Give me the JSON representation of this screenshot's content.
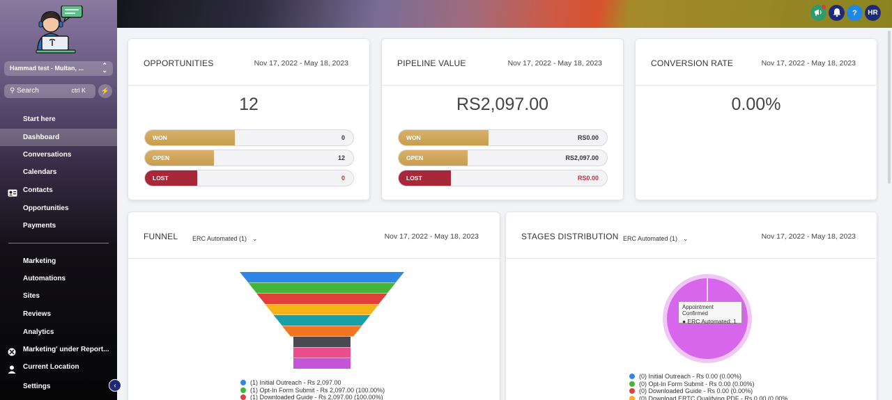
{
  "sidebar": {
    "account": "Hammad test - Multan, ...",
    "search_label": "Search",
    "search_shortcut": "ctrl K",
    "items": [
      {
        "label": "Start here"
      },
      {
        "label": "Dashboard"
      },
      {
        "label": "Conversations"
      },
      {
        "label": "Calendars"
      },
      {
        "label": "Contacts"
      },
      {
        "label": "Opportunities"
      },
      {
        "label": "Payments"
      },
      {
        "label": "Marketing"
      },
      {
        "label": "Automations"
      },
      {
        "label": "Sites"
      },
      {
        "label": "Reviews"
      },
      {
        "label": "Analytics"
      },
      {
        "label": "Marketing' under Report..."
      },
      {
        "label": "Current Location"
      },
      {
        "label": "Settings"
      }
    ]
  },
  "header": {
    "user_initials": "HR",
    "help_label": "?"
  },
  "opportunities": {
    "title": "OPPORTUNITIES",
    "date_range": "Nov 17, 2022 - May 18, 2023",
    "total": "12",
    "rows": [
      {
        "label": "WON",
        "value": "0",
        "fill": 0.43
      },
      {
        "label": "OPEN",
        "value": "12",
        "fill": 0.33
      },
      {
        "label": "LOST",
        "value": "0",
        "fill": 0.25
      }
    ]
  },
  "pipeline": {
    "title": "PIPELINE VALUE",
    "date_range": "Nov 17, 2022 - May 18, 2023",
    "total": "RS2,097.00",
    "rows": [
      {
        "label": "WON",
        "value": "RS0.00",
        "fill": 0.43
      },
      {
        "label": "OPEN",
        "value": "RS2,097.00",
        "fill": 0.33
      },
      {
        "label": "LOST",
        "value": "RS0.00",
        "fill": 0.25
      }
    ]
  },
  "conversion": {
    "title": "CONVERSION RATE",
    "date_range": "Nov 17, 2022 - May 18, 2023",
    "value": "0.00%"
  },
  "funnel": {
    "title": "FUNNEL",
    "pipeline_select": "ERC Automated (1)",
    "date_range": "Nov 17, 2022 - May 18, 2023",
    "layer_colors": [
      "#2f86e6",
      "#43b53a",
      "#e0403a",
      "#f5b318",
      "#17a0a8",
      "#f37421",
      "#4a4a52",
      "#ec4d8d",
      "#c455d8"
    ],
    "legend": [
      {
        "text": "(1) Initial Outreach - Rs 2,097.00",
        "color": "#2f86e6"
      },
      {
        "text": "(1) Opt-In Form Submit - Rs 2,097.00 (100.00%)",
        "color": "#43b53a"
      },
      {
        "text": "(1) Downloaded Guide - Rs 2,097.00 (100.00%)",
        "color": "#e0403a"
      }
    ]
  },
  "stages": {
    "title": "STAGES DISTRIBUTION",
    "pipeline_select": "ERC Automated (1)",
    "date_range": "Nov 17, 2022 - May 18, 2023",
    "pie_color": "#d866ec",
    "tooltip_title": "Appointment Confirmed",
    "tooltip_value": "● ERC Automated: 1",
    "legend": [
      {
        "text": "(0) Initial Outreach - Rs 0.00 (0.00%)",
        "color": "#2f86e6"
      },
      {
        "text": "(0) Opt-In Form Submit - Rs 0.00 (0.00%)",
        "color": "#43b53a"
      },
      {
        "text": "(0) Downloaded Guide - Rs 0.00 (0.00%)",
        "color": "#e0403a"
      },
      {
        "text": "(0) Download ERTC Qualifying PDF - Rs 0.00 (0.00%",
        "color": "#f5b318"
      }
    ]
  }
}
